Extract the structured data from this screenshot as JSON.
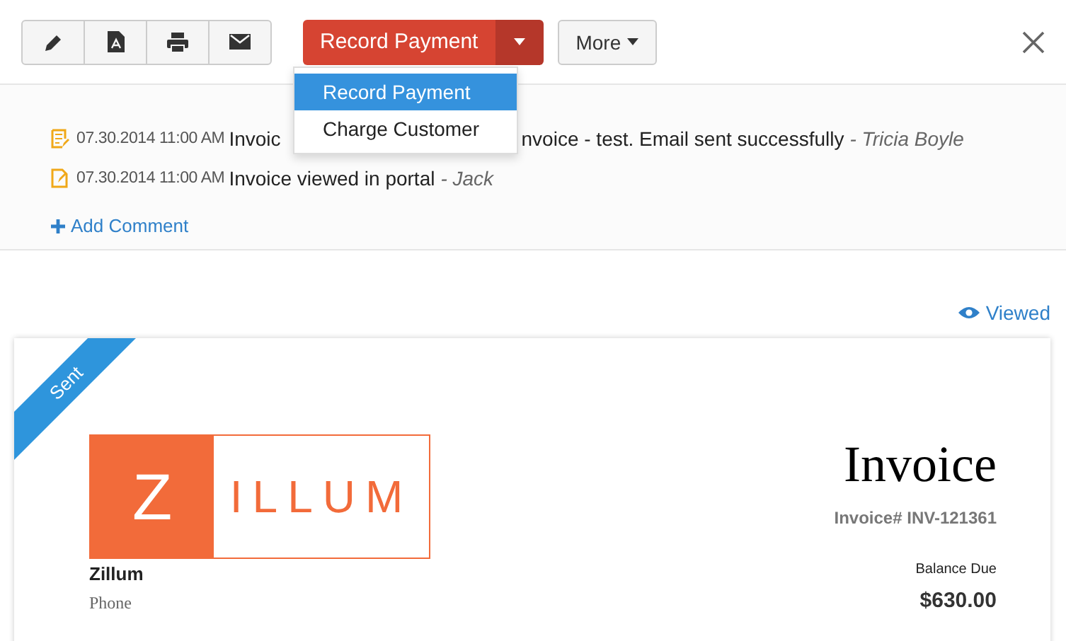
{
  "toolbar": {
    "icon_buttons": [
      {
        "kind": "edit"
      },
      {
        "kind": "pdf"
      },
      {
        "kind": "print"
      },
      {
        "kind": "mail"
      }
    ],
    "primary_button": "Record Payment",
    "more_button": "More"
  },
  "dropdown": {
    "items": [
      {
        "label": "Record Payment",
        "selected": true
      },
      {
        "label": "Charge Customer",
        "selected": false
      }
    ]
  },
  "history": [
    {
      "kind": "sent",
      "time": "07.30.2014 11:00 AM",
      "message_start": "Invoic",
      "message_end": "nvoice - test. Email sent successfully",
      "author": "- Tricia Boyle"
    },
    {
      "kind": "viewed",
      "time": "07.30.2014 11:00 AM",
      "message_start": "Invoice viewed in portal",
      "author": "- Jack"
    }
  ],
  "add_comment": "Add Comment",
  "status_link": "Viewed",
  "invoice": {
    "ribbon": "Sent",
    "logo_letter": "Z",
    "logo_word": "ILLUM",
    "company": "Zillum",
    "phone_label": "Phone",
    "title": "Invoice",
    "number": "Invoice# INV-121361",
    "balance_label": "Balance Due",
    "balance": "$630.00"
  }
}
